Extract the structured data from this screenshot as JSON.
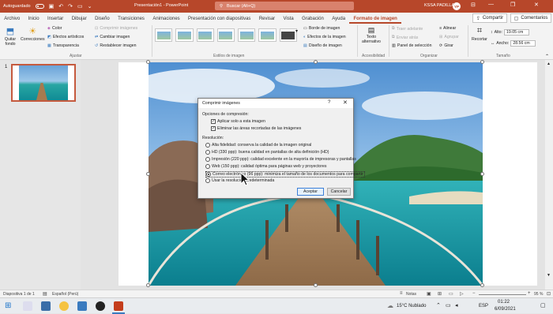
{
  "titlebar": {
    "autosave_label": "Autoguardado",
    "autosave_state": "off",
    "doc_title": "Presentación1 - PowerPoint",
    "search_placeholder": "Buscar (Alt+Q)",
    "user_name": "KSSA PADILLA",
    "avatar_initials": "YP",
    "minimize": "—",
    "restore": "❐",
    "close": "✕"
  },
  "tabs": [
    {
      "label": "Archivo"
    },
    {
      "label": "Inicio"
    },
    {
      "label": "Insertar"
    },
    {
      "label": "Dibujar"
    },
    {
      "label": "Diseño"
    },
    {
      "label": "Transiciones"
    },
    {
      "label": "Animaciones"
    },
    {
      "label": "Presentación con diapositivas"
    },
    {
      "label": "Revisar"
    },
    {
      "label": "Vista"
    },
    {
      "label": "Grabación"
    },
    {
      "label": "Ayuda"
    },
    {
      "label": "Formato de imagen",
      "active": true
    }
  ],
  "share_label": "Compartir",
  "comments_label": "Comentarios",
  "ribbon": {
    "remove_bg": "Quitar fondo",
    "corrections": "Correcciones",
    "color": "Color",
    "artistic": "Efectos artísticos",
    "transparency": "Transparencia",
    "compress": "Comprimir imágenes",
    "change": "Cambiar imagen",
    "reset": "Restablecer imagen",
    "group_adjust": "Ajustar",
    "group_styles": "Estilos de imagen",
    "border": "Borde de imagen",
    "effects": "Efectos de la imagen",
    "layout": "Diseño de imagen",
    "alt_text_1": "Texto",
    "alt_text_2": "alternativo",
    "group_access": "Accesibilidad",
    "bring_forward": "Traer adelante",
    "send_backward": "Enviar atrás",
    "selection_pane": "Panel de selección",
    "align": "Alinear",
    "group": "Agrupar",
    "rotate": "Girar",
    "group_arrange": "Organizar",
    "crop": "Recortar",
    "height_label": "Alto:",
    "height_value": "19.05 cm",
    "width_label": "Ancho:",
    "width_value": "28.56 cm",
    "group_size": "Tamaño"
  },
  "thumb_number": "1",
  "dialog": {
    "title": "Comprimir imágenes",
    "help": "?",
    "close": "✕",
    "compress_options_label": "Opciones de compresión:",
    "apply_only": "Aplicar solo a esta imagen",
    "delete_cropped": "Eliminar las áreas recortadas de las imágenes",
    "resolution_label": "Resolución:",
    "resolutions": [
      {
        "label": "Alta fidelidad: conserva la calidad de la imagen original",
        "selected": false
      },
      {
        "label": "HD (330 ppp): buena calidad en pantallas de alta definición (HD)",
        "selected": false
      },
      {
        "label": "Impresión (220 ppp): calidad excelente en la mayoría de impresoras y pantallas",
        "selected": false
      },
      {
        "label": "Web (150 ppp): calidad óptima para páginas web y proyectores",
        "selected": false
      },
      {
        "label": "Correo electrónico (96 ppp): minimiza el tamaño de los documentos para compartir",
        "selected": true
      },
      {
        "label": "Usar la resolución predeterminada",
        "selected": false
      }
    ],
    "accept": "Aceptar",
    "cancel": "Cancelar"
  },
  "statusbar": {
    "slide_info": "Diapositiva 1 de 1",
    "language": "Español (Perú)",
    "notes": "Notas",
    "zoom": "95 %"
  },
  "taskbar": {
    "weather": "15°C  Nublado",
    "lang": "ESP",
    "time": "01:22",
    "date": "6/09/2021"
  },
  "colors": {
    "accent": "#b7472a",
    "dialog_bg": "#f0f0f0"
  }
}
